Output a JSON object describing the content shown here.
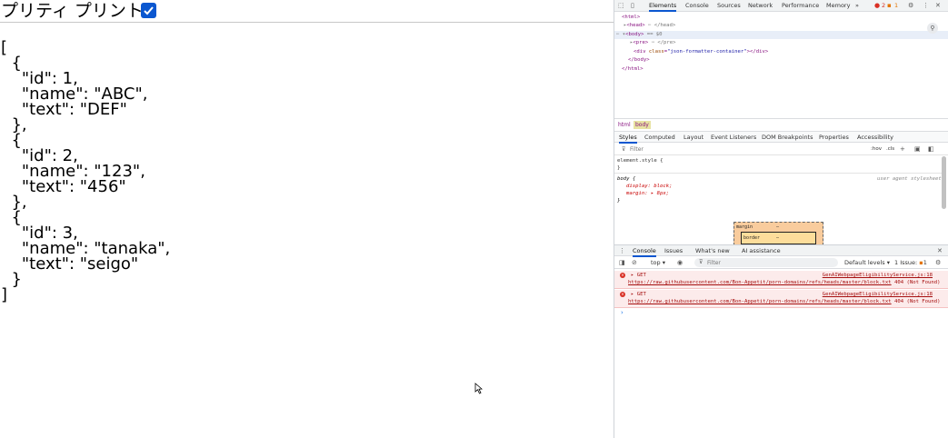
{
  "page": {
    "pretty_print_label": "プリティ プリント",
    "pretty_print_checked": true,
    "json_text": "[\n  {\n    \"id\": 1,\n    \"name\": \"ABC\",\n    \"text\": \"DEF\"\n  },\n  {\n    \"id\": 2,\n    \"name\": \"123\",\n    \"text\": \"456\"\n  },\n  {\n    \"id\": 3,\n    \"name\": \"tanaka\",\n    \"text\": \"seigo\"\n  }\n]"
  },
  "devtools": {
    "tabs": [
      "Elements",
      "Console",
      "Sources",
      "Network",
      "Performance",
      "Memory"
    ],
    "active_tab": "Elements",
    "more_tabs": "»",
    "error_count": "2",
    "warning_count": "1",
    "dom": {
      "html_open": "<html>",
      "head": "<head>",
      "head_rest": " ⋯ </head>",
      "body_open": "<body>",
      "body_eq": " == $0",
      "pre": "<pre>",
      "pre_rest": " ⋯ </pre>",
      "div_open": "<div ",
      "div_attr": "class",
      "div_val": "\"json-formatter-container\"",
      "div_close": "></div>",
      "body_close": "</body>",
      "html_close": "</html>"
    },
    "breadcrumbs": [
      "html",
      "body"
    ],
    "subtabs": [
      "Styles",
      "Computed",
      "Layout",
      "Event Listeners",
      "DOM Breakpoints",
      "Properties",
      "Accessibility"
    ],
    "styles_filter_placeholder": "Filter",
    "hov": ":hov",
    "cls": ".cls",
    "styles": {
      "element_style": "element.style {",
      "brace_close": "}",
      "body_selector": "body {",
      "ua_label": "user agent stylesheet",
      "rule1": "display: block;",
      "rule2": "margin: ▸ 8px;",
      "body_close": "}"
    },
    "box_model": {
      "margin_label": "margin",
      "margin_val": "–",
      "border_label": "border",
      "border_val": "–"
    },
    "console_tabs": [
      "Console",
      "Issues",
      "What's new",
      "AI assistance"
    ],
    "console_toolbar": {
      "context": "top",
      "filter_placeholder": "Filter",
      "levels": "Default levels",
      "issues": "1 Issue: ",
      "issues_count": "1"
    },
    "messages": [
      {
        "method": "▸ GET",
        "source": "GenAIWebpageEligibilityService.js:18",
        "url": "https://raw.githubusercontent.com/Bon-Appetit/porn-domains/refs/heads/master/block.txt",
        "status": " 404 (Not Found)"
      },
      {
        "method": "▸ GET",
        "source": "GenAIWebpageEligibilityService.js:18",
        "url": "https://raw.githubusercontent.com/Bon-Appetit/porn-domains/refs/heads/master/block.txt",
        "status": " 404 (Not Found)"
      }
    ],
    "prompt_symbol": "›"
  },
  "colors": {
    "checkbox": "#0b57d0",
    "error_bg": "#fcebeb",
    "error_text": "#a50e0e"
  }
}
